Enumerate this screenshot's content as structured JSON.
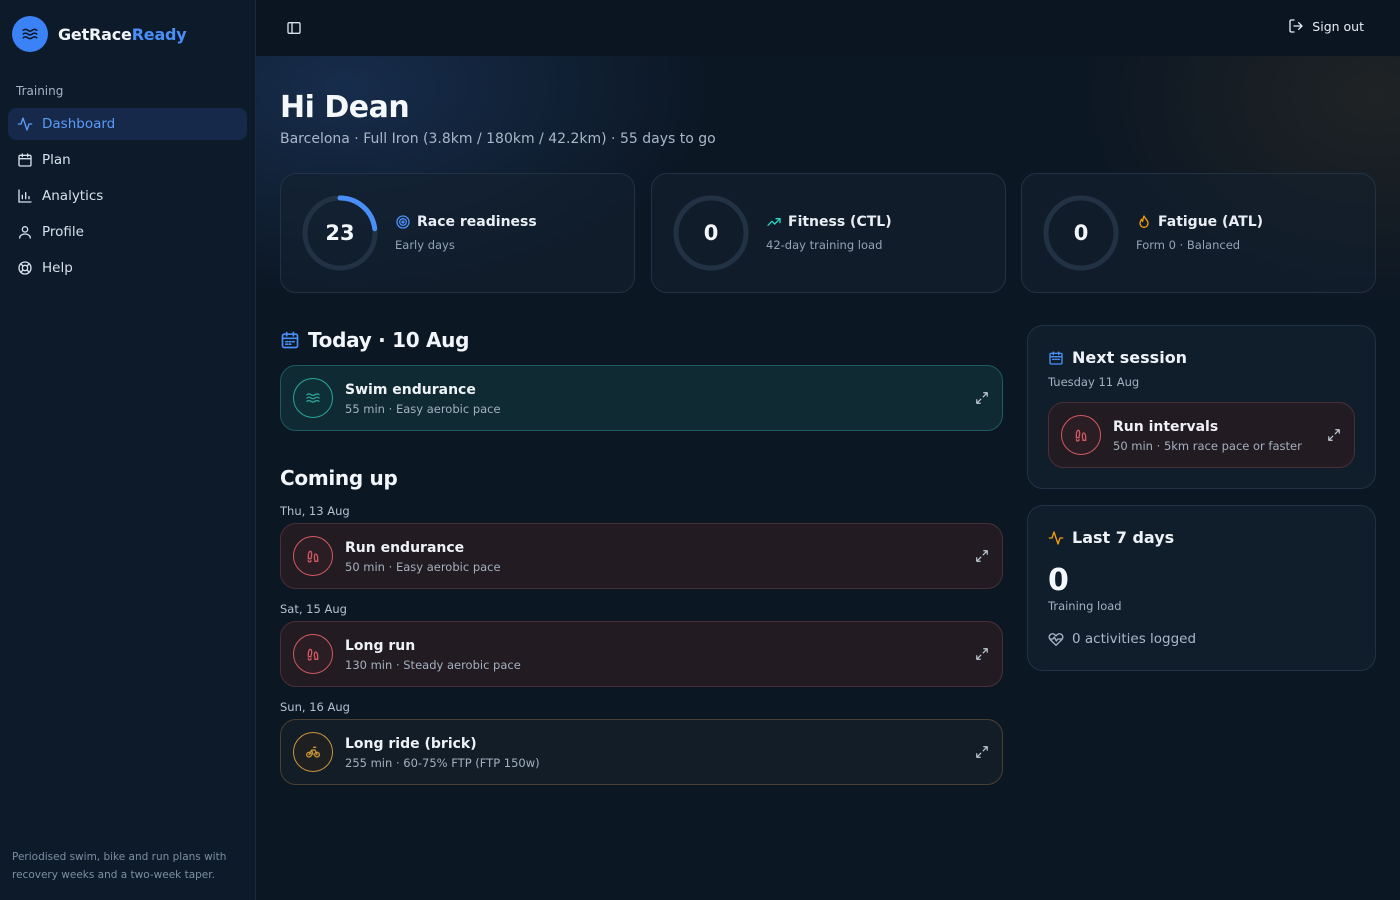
{
  "brand": {
    "name_part1": "GetRace",
    "name_part2": "Ready",
    "logo_icon": "waves-icon"
  },
  "sidebar": {
    "section_label": "Training",
    "items": [
      {
        "label": "Dashboard",
        "icon": "activity-icon",
        "active": true
      },
      {
        "label": "Plan",
        "icon": "calendar-icon"
      },
      {
        "label": "Analytics",
        "icon": "bar-chart-icon"
      },
      {
        "label": "Profile",
        "icon": "user-icon"
      },
      {
        "label": "Help",
        "icon": "lifebuoy-icon"
      }
    ],
    "footer_text": "Periodised swim, bike and run plans with recovery weeks and a two-week taper."
  },
  "topbar": {
    "signout_label": "Sign out"
  },
  "header": {
    "greeting": "Hi Dean",
    "subtitle": "Barcelona · Full Iron (3.8km / 180km / 42.2km) · 55 days to go"
  },
  "stats": [
    {
      "value": "23",
      "fraction": 0.23,
      "title": "Race readiness",
      "sub": "Early days",
      "icon": "target-icon",
      "color": "#4a8ff7"
    },
    {
      "value": "0",
      "fraction": 0,
      "title": "Fitness (CTL)",
      "sub": "42-day training load",
      "icon": "trending-up-icon",
      "color": "#2dd4bf"
    },
    {
      "value": "0",
      "fraction": 0,
      "title": "Fatigue (ATL)",
      "sub": "Form 0 · Balanced",
      "icon": "flame-icon",
      "color": "#f59e0b"
    }
  ],
  "today": {
    "heading": "Today · 10 Aug",
    "session": {
      "title": "Swim endurance",
      "sub": "55 min · Easy aerobic pace"
    }
  },
  "coming_up": {
    "heading": "Coming up",
    "groups": [
      {
        "date": "Thu, 13 Aug",
        "title": "Run endurance",
        "sub": "50 min · Easy aerobic pace"
      },
      {
        "date": "Sat, 15 Aug",
        "title": "Long run",
        "sub": "130 min · Steady aerobic pace"
      },
      {
        "date": "Sun, 16 Aug",
        "title": "Long ride (brick)",
        "sub": "255 min · 60-75% FTP (FTP 150w)"
      }
    ]
  },
  "next_session": {
    "title": "Next session",
    "date": "Tuesday 11 Aug",
    "session": {
      "title": "Run intervals",
      "sub": "50 min · 5km race pace or faster"
    }
  },
  "last7": {
    "title": "Last 7 days",
    "value": "0",
    "label": "Training load",
    "activities": "0 activities logged"
  }
}
